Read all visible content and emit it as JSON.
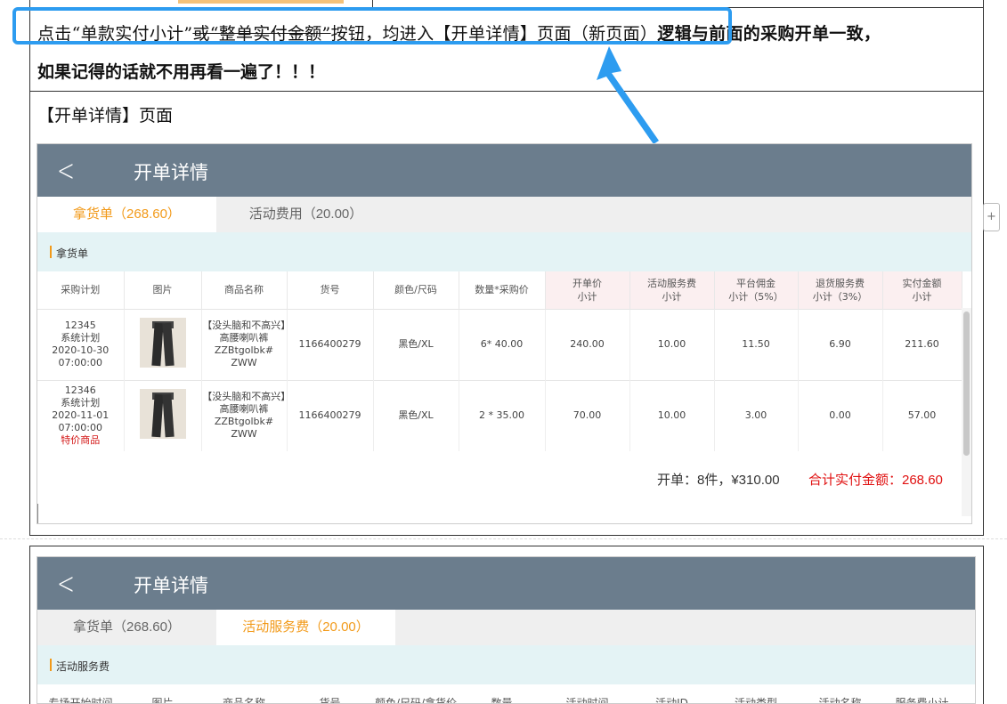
{
  "doc": {
    "line1_pre": "点击“单款实付小计”",
    "line1_strike": "或“整单实付金额”",
    "line1_post": "按钮，均进入【开单详情】页面（新页面）",
    "line1_bold": "逻辑与前面的采购开单一致，",
    "line2": "如果记得的话就不用再看一遍了！！！",
    "section_label": "【开单详情】页面"
  },
  "colors": {
    "header_bg": "#6b7d8d",
    "accent_orange": "#f29a1a",
    "callout_blue": "#2d9cf0",
    "special_red": "#d31616"
  },
  "screen1": {
    "back_icon": "chevron-left-icon",
    "title": "开单详情",
    "tabs": [
      {
        "label": "拿货单（268.60）",
        "active": true
      },
      {
        "label": "活动费用（20.00）",
        "active": false
      }
    ],
    "section_title": "拿货单",
    "columns": [
      "采购计划",
      "图片",
      "商品名称",
      "货号",
      "颜色/尺码",
      "数量*采购价",
      "开单价\n小计",
      "活动服务费\n小计",
      "平台佣金\n小计（5%）",
      "退货服务费\n小计（3%）",
      "实付金额\n小计"
    ],
    "rows": [
      {
        "plan_no": "12345",
        "plan_type": "系统计划",
        "date": "2020-10-30",
        "time": "07:00:00",
        "tag": "",
        "name": "【没头脑和不高兴】高腰喇叭裤ZZBtgolbk# ZWW",
        "sku": "1166400279",
        "color_size": "黑色/XL",
        "qty_price": "6* 40.00",
        "open_price": "240.00",
        "activity_fee": "10.00",
        "commission": "11.50",
        "return_fee": "6.90",
        "paid": "211.60"
      },
      {
        "plan_no": "12346",
        "plan_type": "系统计划",
        "date": "2020-11-01",
        "time": "07:00:00",
        "tag": "特价商品",
        "name": "【没头脑和不高兴】高腰喇叭裤ZZBtgolbk# ZWW",
        "sku": "1166400279",
        "color_size": "黑色/XL",
        "qty_price": "2 * 35.00",
        "open_price": "70.00",
        "activity_fee": "10.00",
        "commission": "3.00",
        "return_fee": "0.00",
        "paid": "57.00"
      }
    ],
    "summary_count": "开单：8件，¥310.00",
    "summary_total": "合计实付金额：268.60"
  },
  "screen2": {
    "title": "开单详情",
    "tabs": [
      {
        "label": "拿货单（268.60）",
        "active": false
      },
      {
        "label": "活动服务费（20.00）",
        "active": true
      }
    ],
    "section_title": "活动服务费",
    "columns": [
      "专场开始时间",
      "图片",
      "商品名称",
      "货号",
      "颜色/尺码/拿货价",
      "数量",
      "活动时间",
      "活动ID",
      "活动类型",
      "活动名称",
      "服务费小计"
    ]
  },
  "side_button": "+"
}
